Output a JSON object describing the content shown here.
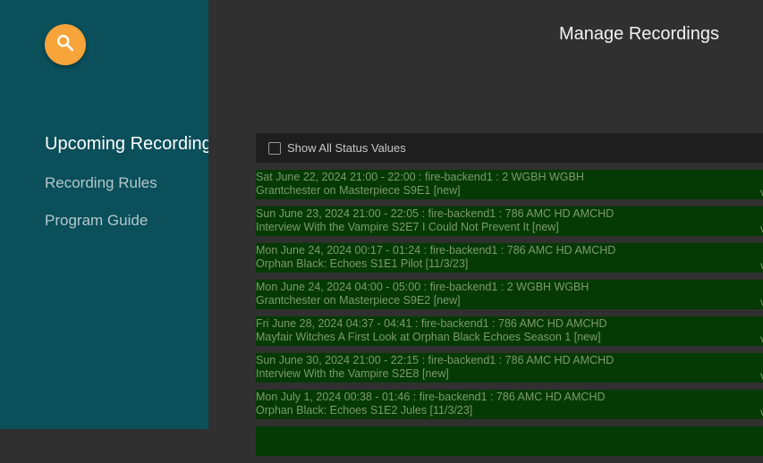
{
  "sidebar": {
    "search_icon": "search-icon",
    "items": [
      {
        "label": "Upcoming Recordings",
        "active": true
      },
      {
        "label": "Recording Rules",
        "active": false
      },
      {
        "label": "Program Guide",
        "active": false
      }
    ]
  },
  "header": {
    "title": "Manage Recordings"
  },
  "filter": {
    "label": "Show All Status Values",
    "checked": false
  },
  "recordings": [
    {
      "line1": "Sat June 22, 2024 21:00 - 22:00 : fire-backend1 : 2 WGBH WGBH",
      "line2": "Grantchester on Masterpiece  S9E1  [new]",
      "mark": "v"
    },
    {
      "line1": "Sun June 23, 2024 21:00 - 22:05 : fire-backend1 : 786 AMC HD AMCHD",
      "line2": "Interview With the Vampire  S2E7 I Could Not Prevent It [new]",
      "mark": "v"
    },
    {
      "line1": "Mon June 24, 2024 00:17 - 01:24 : fire-backend1 : 786 AMC HD AMCHD",
      "line2": "Orphan Black: Echoes  S1E1 Pilot [11/3/23]",
      "mark": "v"
    },
    {
      "line1": "Mon June 24, 2024 04:00 - 05:00 : fire-backend1 : 2 WGBH WGBH",
      "line2": "Grantchester on Masterpiece  S9E2  [new]",
      "mark": "v"
    },
    {
      "line1": "Fri June 28, 2024 04:37 - 04:41 : fire-backend1 : 786 AMC HD AMCHD",
      "line2": "Mayfair Witches  A First Look at Orphan Black Echoes Season 1 [new]",
      "mark": "v"
    },
    {
      "line1": "Sun June 30, 2024 21:00 - 22:15 : fire-backend1 : 786 AMC HD AMCHD",
      "line2": "Interview With the Vampire  S2E8  [new]",
      "mark": "v"
    },
    {
      "line1": "Mon July 1, 2024 00:38 - 01:46 : fire-backend1 : 786 AMC HD AMCHD",
      "line2": "Orphan Black: Echoes  S1E2 Jules [11/3/23]",
      "mark": "v"
    },
    {
      "line1": "",
      "line2": "",
      "mark": ""
    }
  ],
  "colors": {
    "sidebar_bg": "#0a4f5a",
    "accent": "#f7a43a",
    "content_bg": "#303030",
    "row_bg": "#053a05",
    "row_text": "#7c9a6c"
  }
}
